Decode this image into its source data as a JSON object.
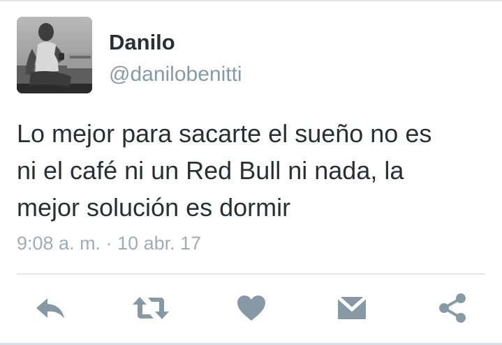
{
  "tweet": {
    "author": {
      "display_name": "Danilo",
      "handle": "@danilobenitti"
    },
    "text_lines": [
      "Lo mejor para sacarte el sueño no es",
      "ni el café ni un Red Bull ni nada, la",
      "mejor solución es dormir"
    ],
    "timestamp": "9:08 a. m. · 10 abr. 17"
  },
  "actions": [
    {
      "icon": "reply-icon"
    },
    {
      "icon": "retweet-icon"
    },
    {
      "icon": "heart-icon"
    },
    {
      "icon": "envelope-icon"
    },
    {
      "icon": "share-icon"
    }
  ],
  "colors": {
    "text": "#292f33",
    "secondary": "#8899a6",
    "action_icon": "#8899a6",
    "divider": "#e1e8ed"
  }
}
